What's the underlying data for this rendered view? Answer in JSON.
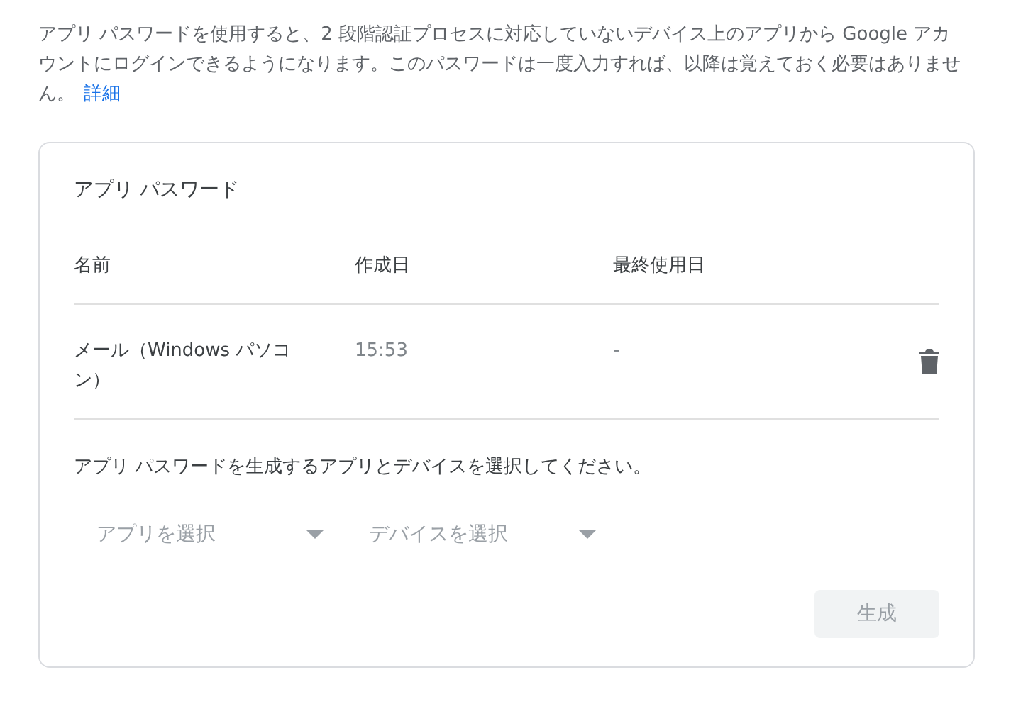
{
  "intro": {
    "text": "アプリ パスワードを使用すると、2 段階認証プロセスに対応していないデバイス上のアプリから Google アカウントにログインできるようになります。このパスワードは一度入力すれば、以降は覚えておく必要はありません。",
    "link": "詳細"
  },
  "card": {
    "title": "アプリ パスワード",
    "columns": [
      "名前",
      "作成日",
      "最終使用日"
    ],
    "rows": [
      {
        "name": "メール（Windows パソコン）",
        "created": "15:53",
        "last_used": "-"
      }
    ],
    "instruction": "アプリ パスワードを生成するアプリとデバイスを選択してください。",
    "selects": [
      {
        "placeholder": "アプリを選択"
      },
      {
        "placeholder": "デバイスを選択"
      }
    ],
    "generate": {
      "label": "生成",
      "disabled": true
    }
  }
}
